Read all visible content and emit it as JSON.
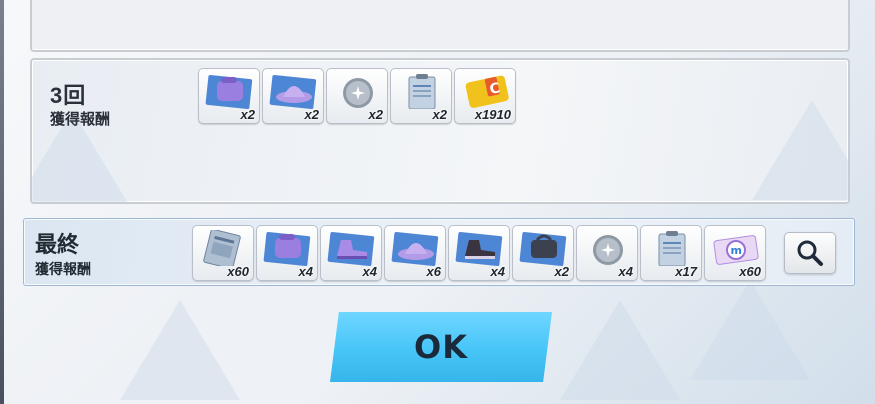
{
  "round_section": {
    "title": "3回",
    "subtitle": "獲得報酬",
    "items": [
      {
        "icon": "purple-bag-icon",
        "qty": "x2"
      },
      {
        "icon": "purple-hat-icon",
        "qty": "x2"
      },
      {
        "icon": "silver-orb-icon",
        "qty": "x2"
      },
      {
        "icon": "clipboard-document-icon",
        "qty": "x2"
      },
      {
        "icon": "gold-coin-card-icon",
        "qty": "x1910"
      }
    ]
  },
  "final_section": {
    "title": "最終",
    "subtitle": "獲得報酬",
    "items": [
      {
        "icon": "data-card-icon",
        "qty": "x60"
      },
      {
        "icon": "purple-bag-icon",
        "qty": "x4"
      },
      {
        "icon": "purple-shoes-icon",
        "qty": "x4"
      },
      {
        "icon": "purple-hat-icon",
        "qty": "x6"
      },
      {
        "icon": "dark-shoes-icon",
        "qty": "x4"
      },
      {
        "icon": "dark-bag-icon",
        "qty": "x2"
      },
      {
        "icon": "silver-orb-icon",
        "qty": "x4"
      },
      {
        "icon": "clipboard-document-icon",
        "qty": "x17"
      },
      {
        "icon": "ticket-m-icon",
        "qty": "x60"
      }
    ]
  },
  "ok_button": {
    "label": "OK"
  },
  "colors": {
    "accent": "#47c5f7",
    "text": "#222a33"
  }
}
